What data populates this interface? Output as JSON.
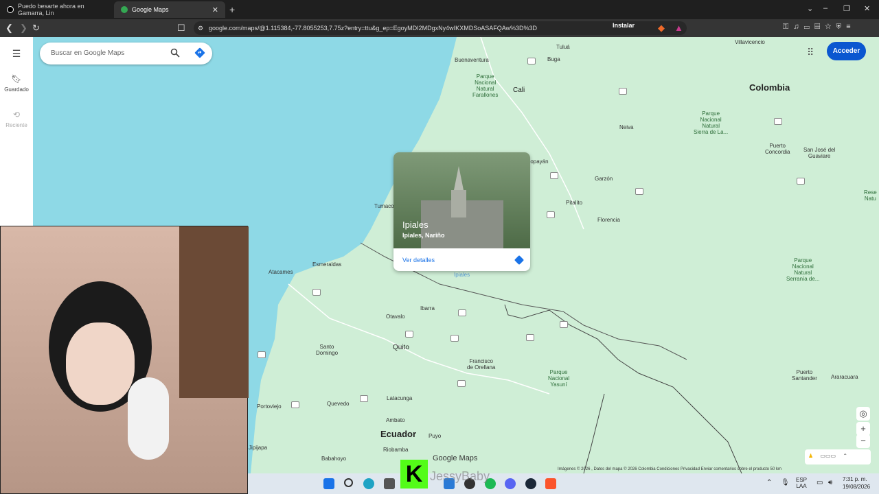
{
  "browser": {
    "tabs": [
      {
        "title": "Puedo besarte ahora en Gamarra, Lin",
        "active": false
      },
      {
        "title": "Google Maps",
        "active": true
      }
    ],
    "url": "google.com/maps/@1.115384,-77.8055253,7.75z?entry=ttu&g_ep=EgoyMDI2MDgxNy4wIKXMDSoASAFQAw%3D%3D",
    "install_label": "Instalar"
  },
  "maps": {
    "search_placeholder": "Buscar en Google Maps",
    "sidebar": [
      {
        "label": "Guardado",
        "icon": "bookmark-icon"
      },
      {
        "label": "Reciente",
        "icon": "history-icon"
      }
    ],
    "signin_label": "Acceder",
    "card": {
      "title": "Ipiales",
      "subtitle": "Ipiales, Nariño",
      "more_label": "Ver detalles"
    },
    "labels": {
      "colombia": "Colombia",
      "ecuador": "Ecuador",
      "quito": "Quito",
      "cali": "Cali",
      "neiva": "Neiva",
      "tulua": "Tuluá",
      "buga": "Buga",
      "buenaventura": "Buenaventura",
      "villavicencio": "Villavicencio",
      "popayan": "Popayán",
      "garzon": "Garzón",
      "pitalito": "Pitalito",
      "florencia": "Florencia",
      "tumaco": "Tumaco",
      "atacames": "Atacames",
      "esmeraldas": "Esmeraldas",
      "ibarra": "Ibarra",
      "otavalo": "Otavalo",
      "santo_domingo": "Santo\nDomingo",
      "francisco": "Francisco\nde Orellana",
      "latacunga": "Latacunga",
      "quevedo": "Quevedo",
      "portoviejo": "Portoviejo",
      "ambato": "Ambato",
      "puyo": "Puyo",
      "riobamba": "Riobamba",
      "babahoyo": "Babahoyo",
      "jipijapa": "Jipijapa",
      "ipiales_pin": "Ipiales",
      "puerto_concordia": "Puerto\nConcordia",
      "san_jose": "San José del\nGuaviare",
      "puerto_santander": "Puerto\nSantander",
      "araracuara": "Araracuara",
      "park_farallones": "Parque\nNacional\nNatural\nFarallones",
      "park_sierra": "Parque\nNacional\nNatural\nSierra de La...",
      "park_yasuni": "Parque\nNacional\nYasuní",
      "park_chiribiquete": "Parque\nNacional\nNatural\nSerranía de...",
      "reserva": "Rese\nNatu"
    },
    "footer": "Imágenes © 2026 , Datos del mapa © 2026   Colombia   Condiciones   Privacidad   Enviar comentarios sobre el producto   50 km",
    "logo_text": "Google Maps"
  },
  "overlay": {
    "watermark": "JessyBaby"
  },
  "taskbar": {
    "lang": "ESP\nLAA",
    "time": "7:31 p. m.",
    "date": "19/08/2026"
  }
}
